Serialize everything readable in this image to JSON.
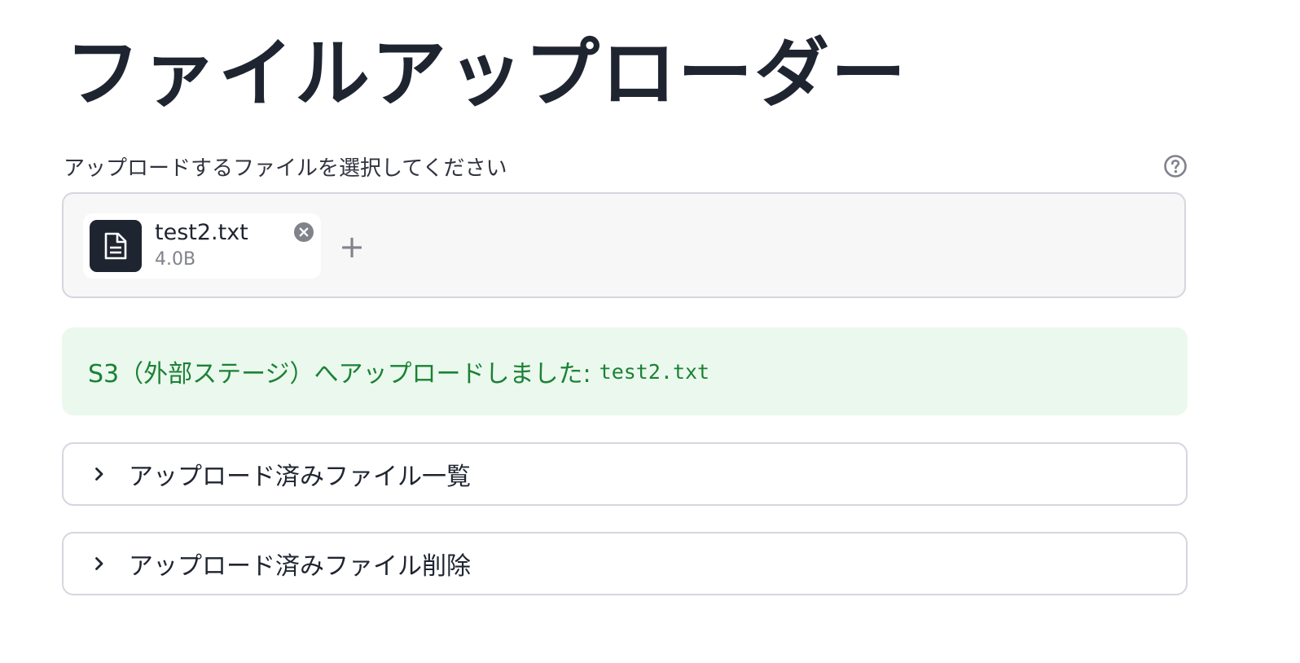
{
  "page": {
    "title": "ファイルアップローダー"
  },
  "uploader": {
    "label": "アップロードするファイルを選択してください",
    "help_icon": "question-circle-icon",
    "add_symbol": "+",
    "file": {
      "name": "test2.txt",
      "size": "4.0B",
      "icon": "document-icon",
      "remove_icon": "close-circle-icon"
    }
  },
  "alert": {
    "message": "S3（外部ステージ）へアップロードしました:",
    "filename": "test2.txt"
  },
  "expanders": [
    {
      "label": "アップロード済みファイル一覧",
      "icon": "chevron-right-icon"
    },
    {
      "label": "アップロード済みファイル削除",
      "icon": "chevron-right-icon"
    }
  ],
  "colors": {
    "text": "#1f2530",
    "muted": "#80828c",
    "border": "#d6d6de",
    "dropzone_bg": "#f7f7f8",
    "success_bg": "#ebf8ee",
    "success_text": "#1a8234"
  }
}
